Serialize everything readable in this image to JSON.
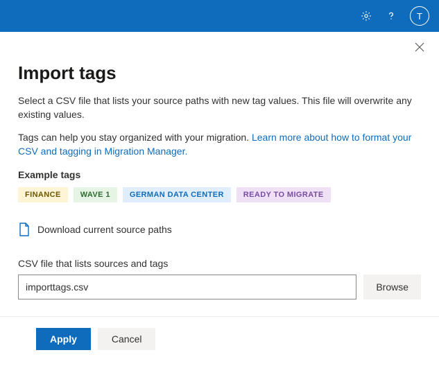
{
  "topbar": {
    "avatar_initial": "T"
  },
  "dialog": {
    "title": "Import tags",
    "desc1": "Select a CSV file that lists your source paths with new tag values. This file will overwrite any existing values.",
    "desc2_prefix": "Tags can help you stay organized with your migration. ",
    "desc2_link": "Learn more about how to format your CSV and tagging in Migration Manager.",
    "example_label": "Example tags",
    "tags": {
      "t0": "FINANCE",
      "t1": "WAVE 1",
      "t2": "GERMAN DATA CENTER",
      "t3": "READY TO MIGRATE"
    },
    "download_label": "Download current source paths",
    "field_label": "CSV file that lists sources and tags",
    "file_value": "importtags.csv",
    "browse_label": "Browse",
    "apply_label": "Apply",
    "cancel_label": "Cancel"
  }
}
